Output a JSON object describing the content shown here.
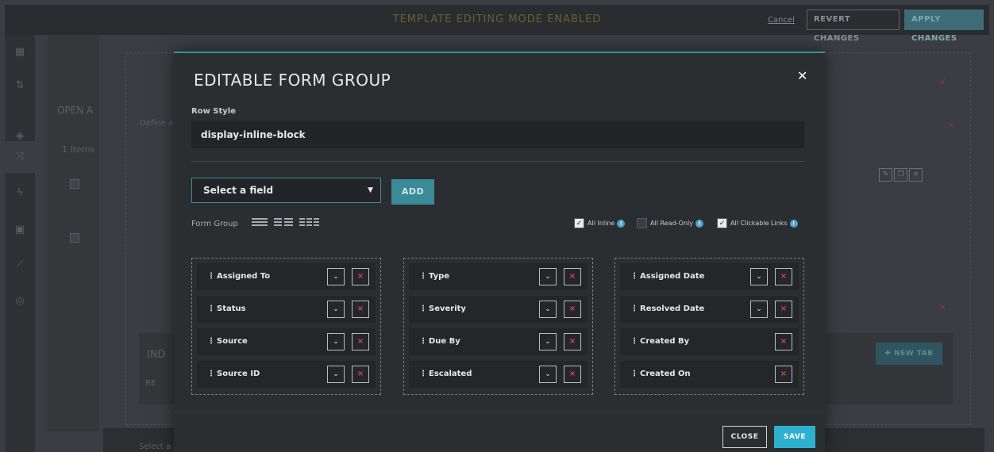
{
  "topbar": {
    "mode_text": "TEMPLATE EDITING MODE ENABLED",
    "cancel_label": "Cancel",
    "revert_label": "REVERT CHANGES",
    "apply_label": "APPLY CHANGES"
  },
  "background": {
    "open_label": "OPEN A",
    "define_label": "Define a",
    "items_label": "1 Items",
    "ind_label": "IND",
    "re_label": "RE",
    "select_label": "Select a",
    "new_tab_label": "NEW TAB"
  },
  "modal": {
    "title": "EDITABLE FORM GROUP",
    "row_style_label": "Row Style",
    "row_style_value": "display-inline-block",
    "select_field_value": "Select a field",
    "add_label": "ADD",
    "form_group_label": "Form Group",
    "options": {
      "all_inline": {
        "label": "All Inline",
        "checked": true
      },
      "all_read_only": {
        "label": "All Read-Only",
        "checked": false
      },
      "all_clickable_links": {
        "label": "All Clickable Links",
        "checked": true
      }
    },
    "columns": [
      [
        {
          "label": "Assigned To",
          "has_dropdown": true
        },
        {
          "label": "Status",
          "has_dropdown": true
        },
        {
          "label": "Source",
          "has_dropdown": true
        },
        {
          "label": "Source ID",
          "has_dropdown": true
        }
      ],
      [
        {
          "label": "Type",
          "has_dropdown": true
        },
        {
          "label": "Severity",
          "has_dropdown": true
        },
        {
          "label": "Due By",
          "has_dropdown": true
        },
        {
          "label": "Escalated",
          "has_dropdown": true
        }
      ],
      [
        {
          "label": "Assigned Date",
          "has_dropdown": true
        },
        {
          "label": "Resolved Date",
          "has_dropdown": true
        },
        {
          "label": "Created By",
          "has_dropdown": false
        },
        {
          "label": "Created On",
          "has_dropdown": false
        }
      ]
    ],
    "close_label": "CLOSE",
    "save_label": "SAVE"
  },
  "colors": {
    "accent": "#3b8e9c",
    "save": "#2fb0cf",
    "remove": "#e0413d",
    "info": "#4ba3c7"
  }
}
